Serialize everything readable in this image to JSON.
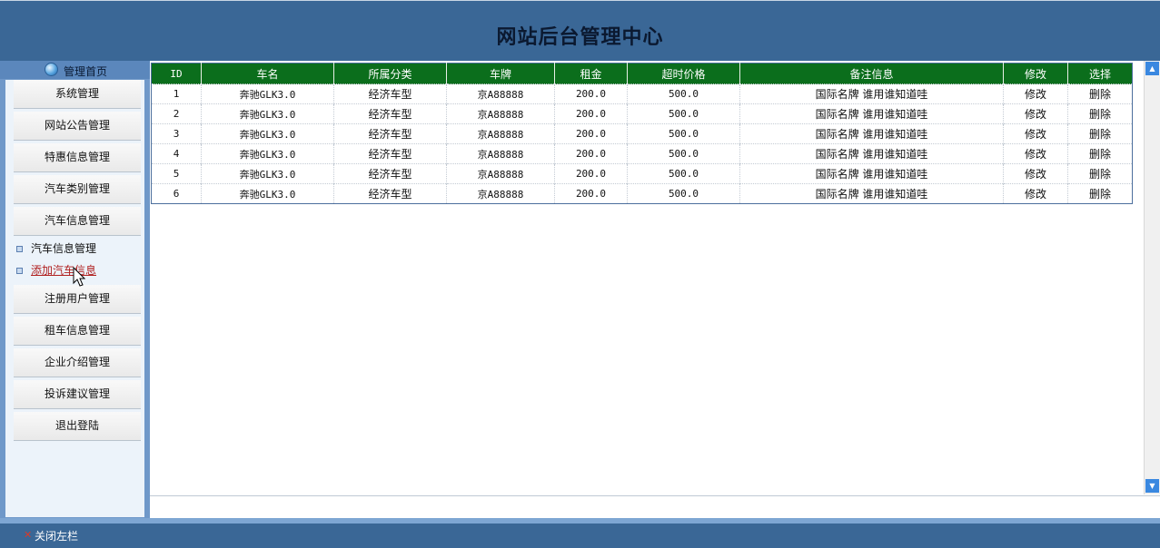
{
  "header": {
    "title": "网站后台管理中心"
  },
  "sidebar": {
    "home_label": "管理首页",
    "items": [
      {
        "label": "系统管理"
      },
      {
        "label": "网站公告管理"
      },
      {
        "label": "特惠信息管理"
      },
      {
        "label": "汽车类别管理"
      },
      {
        "label": "汽车信息管理"
      }
    ],
    "sub_items": [
      {
        "label": "汽车信息管理"
      },
      {
        "label": "添加汽车信息"
      }
    ],
    "items_after": [
      {
        "label": "注册用户管理"
      },
      {
        "label": "租车信息管理"
      },
      {
        "label": "企业介绍管理"
      },
      {
        "label": "投诉建议管理"
      },
      {
        "label": "退出登陆"
      }
    ]
  },
  "table": {
    "columns": [
      "ID",
      "车名",
      "所属分类",
      "车牌",
      "租金",
      "超时价格",
      "备注信息",
      "修改",
      "选择"
    ],
    "rows": [
      {
        "id": "1",
        "name": "奔驰GLK3.0",
        "category": "经济车型",
        "plate": "京A88888",
        "rent": "200.0",
        "overtime": "500.0",
        "note": "国际名牌 谁用谁知道哇",
        "edit": "修改",
        "delete": "删除"
      },
      {
        "id": "2",
        "name": "奔驰GLK3.0",
        "category": "经济车型",
        "plate": "京A88888",
        "rent": "200.0",
        "overtime": "500.0",
        "note": "国际名牌 谁用谁知道哇",
        "edit": "修改",
        "delete": "删除"
      },
      {
        "id": "3",
        "name": "奔驰GLK3.0",
        "category": "经济车型",
        "plate": "京A88888",
        "rent": "200.0",
        "overtime": "500.0",
        "note": "国际名牌 谁用谁知道哇",
        "edit": "修改",
        "delete": "删除"
      },
      {
        "id": "4",
        "name": "奔驰GLK3.0",
        "category": "经济车型",
        "plate": "京A88888",
        "rent": "200.0",
        "overtime": "500.0",
        "note": "国际名牌 谁用谁知道哇",
        "edit": "修改",
        "delete": "删除"
      },
      {
        "id": "5",
        "name": "奔驰GLK3.0",
        "category": "经济车型",
        "plate": "京A88888",
        "rent": "200.0",
        "overtime": "500.0",
        "note": "国际名牌 谁用谁知道哇",
        "edit": "修改",
        "delete": "删除"
      },
      {
        "id": "6",
        "name": "奔驰GLK3.0",
        "category": "经济车型",
        "plate": "京A88888",
        "rent": "200.0",
        "overtime": "500.0",
        "note": "国际名牌 谁用谁知道哇",
        "edit": "修改",
        "delete": "删除"
      }
    ]
  },
  "footer": {
    "close_label": "关闭左栏"
  },
  "colors": {
    "header_bg": "#3a6796",
    "table_header_bg": "#0b6e1c",
    "link_active": "#b02020"
  }
}
